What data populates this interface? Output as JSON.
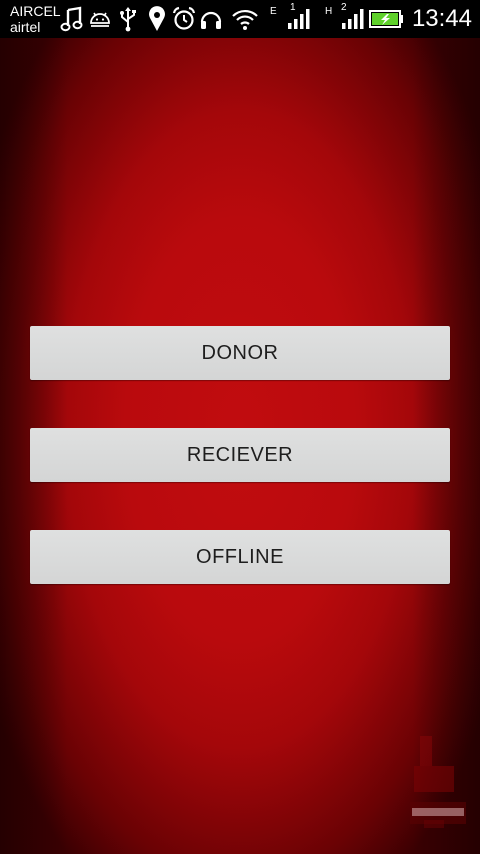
{
  "status_bar": {
    "carrier_1": "AIRCEL",
    "carrier_2": "airtel",
    "network_1": "E",
    "network_1_slot": "1",
    "network_2": "H",
    "network_2_slot": "2",
    "time": "13:44",
    "icons": [
      "music-note-icon",
      "android-icon",
      "usb-icon",
      "location-pin-icon",
      "alarm-clock-icon",
      "headset-icon",
      "wifi-icon",
      "signal-icon",
      "signal-icon",
      "battery-charging-icon"
    ]
  },
  "buttons": {
    "donor": "DONOR",
    "receiver": "RECIEVER",
    "offline": "OFFLINE"
  },
  "colors": {
    "background_red": "#b90a0d",
    "button_gray": "#d8d9d9",
    "status_bar": "#000000",
    "battery_green": "#5fd12b"
  }
}
